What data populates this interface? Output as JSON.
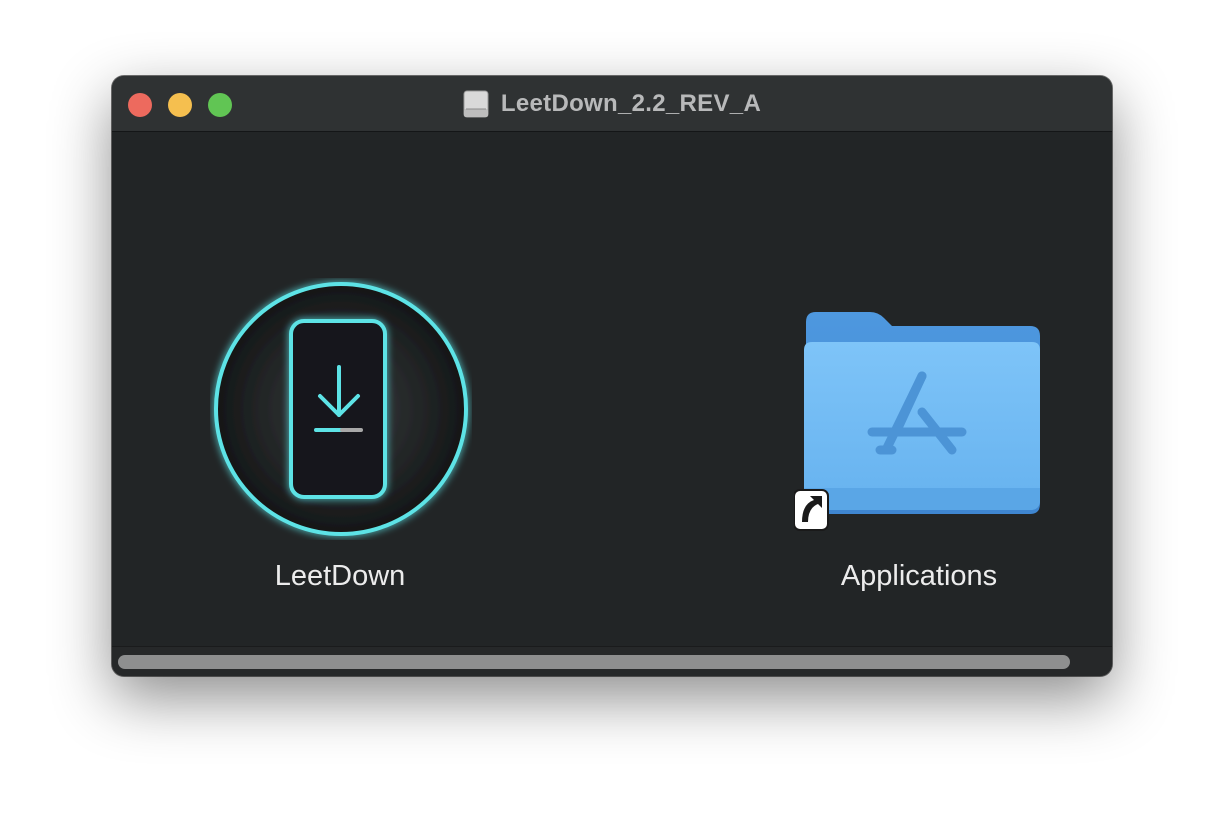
{
  "window": {
    "title": "LeetDown_2.2_REV_A",
    "title_icon": "disk-image-icon"
  },
  "items": {
    "leetdown": {
      "label": "LeetDown",
      "icon": "leetdown-app-icon"
    },
    "applications": {
      "label": "Applications",
      "icon": "applications-folder-icon",
      "badge": "alias-arrow-icon"
    }
  },
  "colors": {
    "close": "#ed6a5e",
    "minimize": "#f5bf4f",
    "zoom": "#61c554",
    "accent_cyan": "#5de3e6",
    "folder_blue": "#6ab8f4"
  }
}
